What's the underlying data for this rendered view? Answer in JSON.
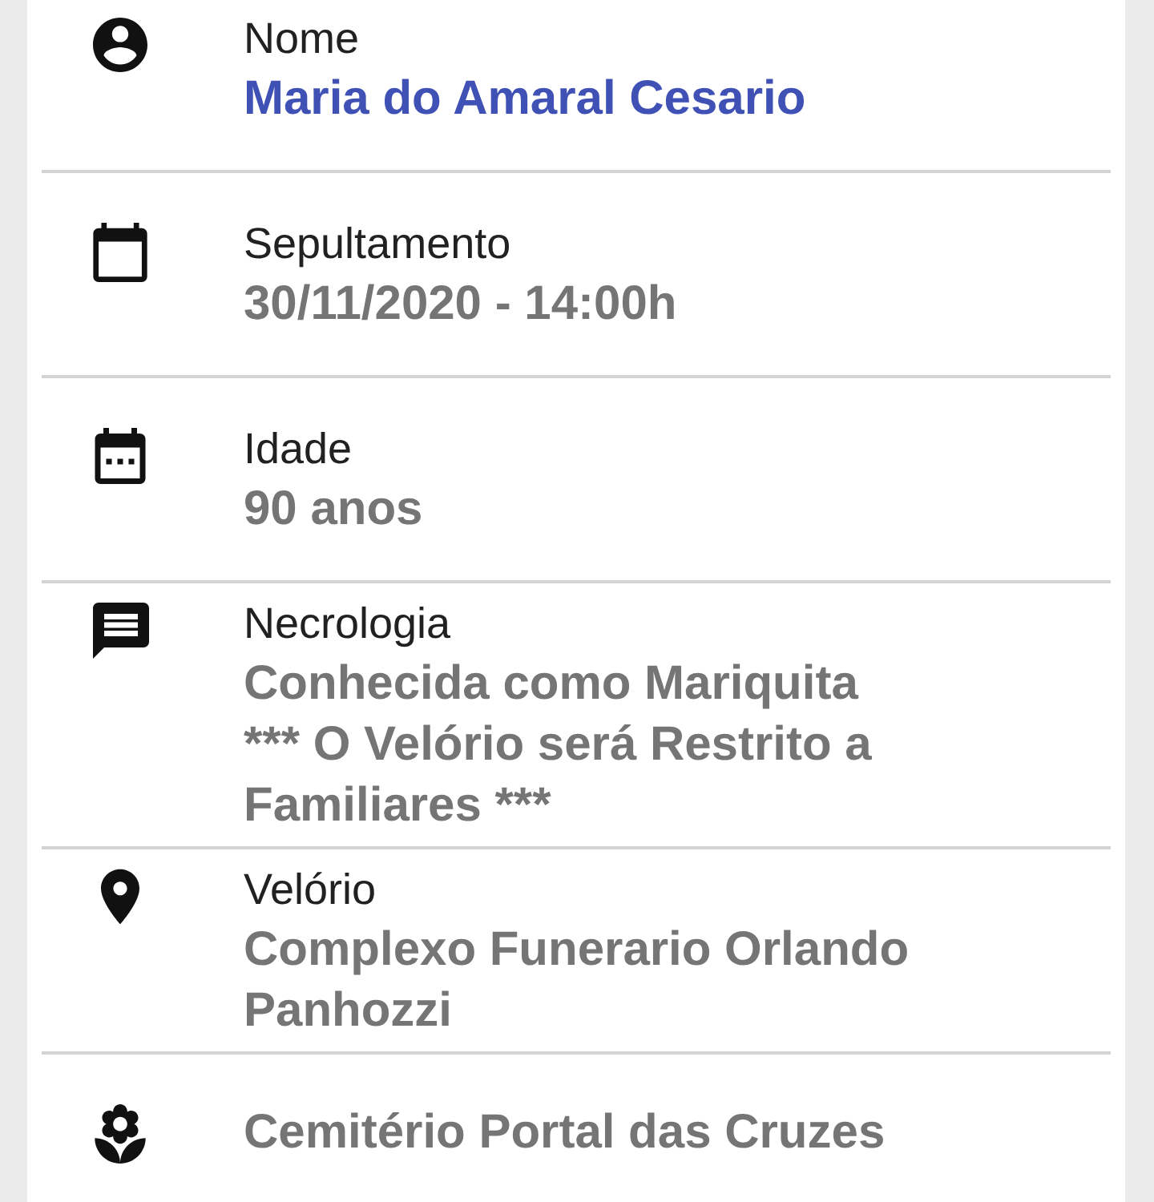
{
  "items": [
    {
      "label": "Nome",
      "value": [
        "Maria do Amaral Cesario"
      ],
      "highlighted": true
    },
    {
      "label": "Sepultamento",
      "value": [
        "30/11/2020 - 14:00h"
      ],
      "highlighted": false
    },
    {
      "label": "Idade",
      "value": [
        "90 anos"
      ],
      "highlighted": false
    },
    {
      "label": "Necrologia",
      "value": [
        "Conhecida como Mariquita",
        "*** O Velório será Restrito a Familiares ***"
      ],
      "highlighted": false
    },
    {
      "label": "Velório",
      "value": [
        "Complexo Funerario Orlando Panhozzi"
      ],
      "highlighted": false
    },
    {
      "value": [
        "Cemitério Portal das Cruzes"
      ],
      "highlighted": false
    }
  ]
}
